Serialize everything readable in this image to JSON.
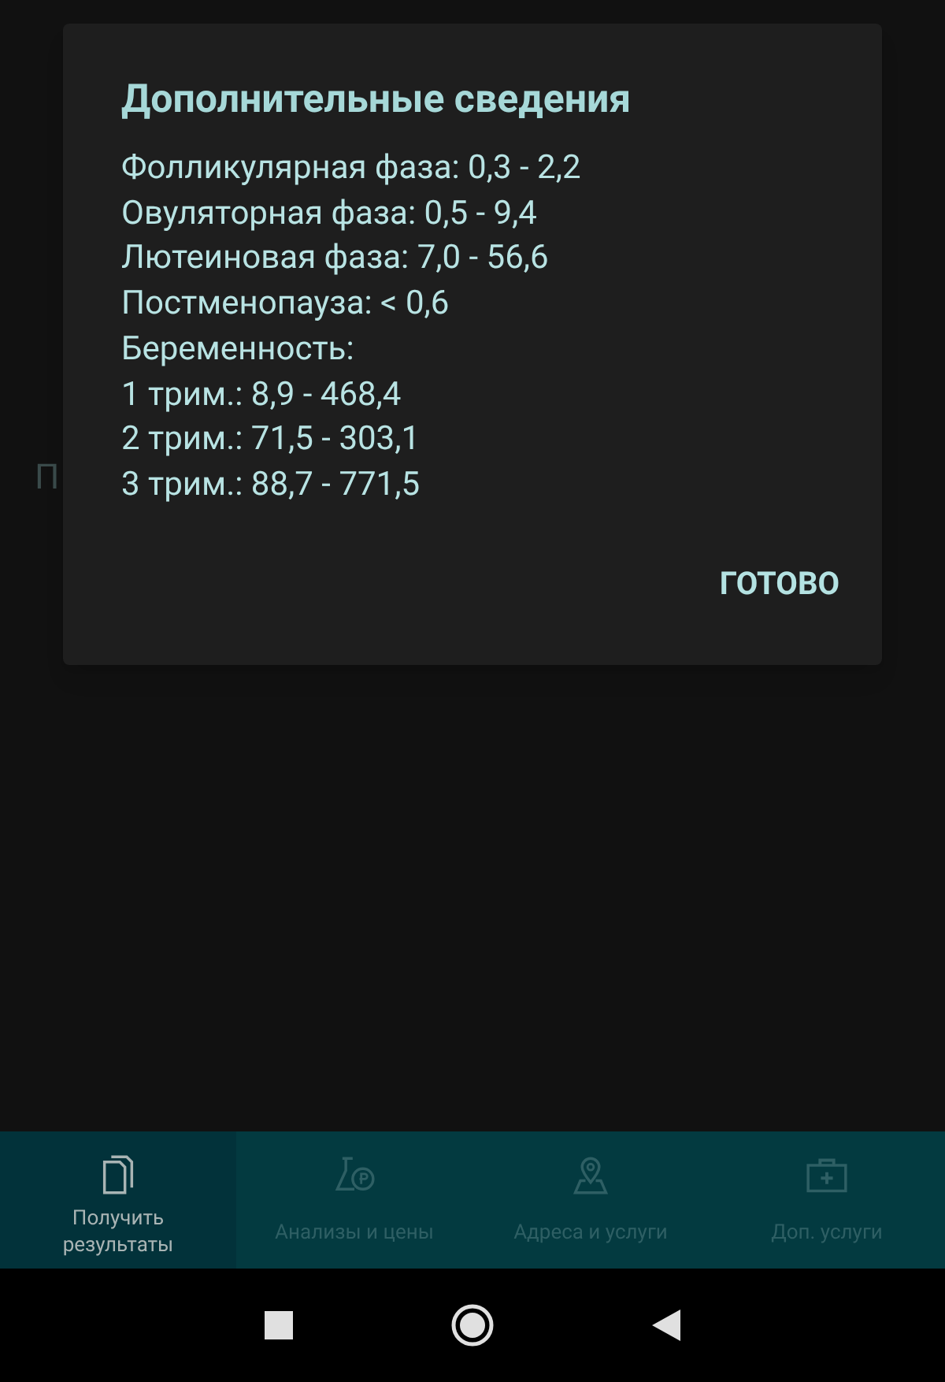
{
  "background": {
    "fragment": "П"
  },
  "dialog": {
    "title": "Дополнительные сведения",
    "lines": [
      "Фолликулярная фаза: 0,3 - 2,2",
      "Овуляторная фаза: 0,5 - 9,4",
      "Лютеиновая фаза: 7,0 - 56,6",
      "Постменопауза: < 0,6",
      "Беременность:",
      "1 трим.: 8,9 - 468,4",
      "2 трим.: 71,5 - 303,1",
      "3 трим.: 88,7 - 771,5"
    ],
    "button": "ГОТОВО"
  },
  "bottom_nav": [
    {
      "kind": "documents",
      "label": "Получить результаты",
      "selected": true
    },
    {
      "kind": "flask",
      "label": "Анализы и цены",
      "selected": false
    },
    {
      "kind": "pin",
      "label": "Адреса и услуги",
      "selected": false
    },
    {
      "kind": "kit",
      "label": "Доп. услуги",
      "selected": false
    }
  ]
}
